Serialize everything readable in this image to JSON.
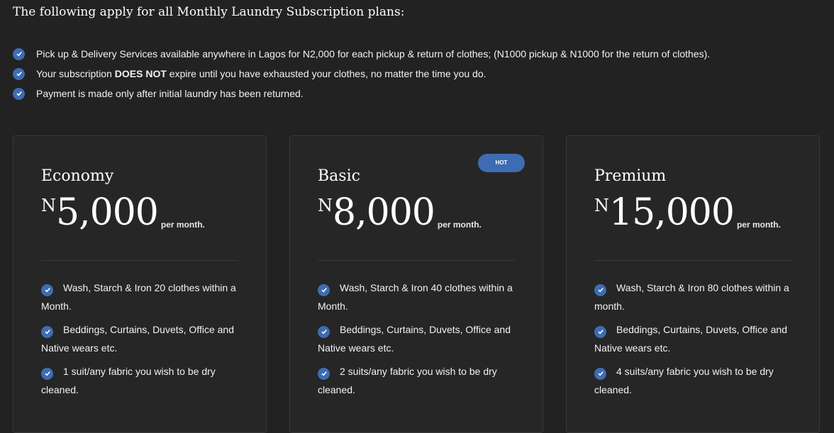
{
  "heading": "The following apply for all Monthly Laundry Subscription plans:",
  "notes": [
    {
      "text": "Pick up & Delivery Services available anywhere in Lagos for N2,000 for each pickup & return of clothes; (N1000 pickup & N1000 for the return of clothes)."
    },
    {
      "before": "Your subscription ",
      "bold": "DOES NOT",
      "after": " expire until you have exhausted your clothes, no matter the time you do."
    },
    {
      "text": "Payment is made only after initial laundry has been returned."
    }
  ],
  "check_icon": "check-circle-icon",
  "accent_color": "#3d6cb3",
  "plans": [
    {
      "name": "Economy",
      "currency": "N",
      "amount": "5,000",
      "period": "per month.",
      "features": [
        "Wash, Starch & Iron 20 clothes within a Month.",
        "Beddings, Curtains, Duvets, Office and Native wears etc.",
        "1 suit/any fabric you wish to be dry cleaned."
      ]
    },
    {
      "name": "Basic",
      "currency": "N",
      "amount": "8,000",
      "period": "per month.",
      "badge": "HOT",
      "features": [
        "Wash, Starch & Iron 40 clothes within a Month.",
        "Beddings, Curtains, Duvets, Office and Native wears etc.",
        "2 suits/any fabric you wish to be dry cleaned."
      ]
    },
    {
      "name": "Premium",
      "currency": "N",
      "amount": "15,000",
      "period": "per month.",
      "features": [
        "Wash, Starch & Iron 80 clothes within a month.",
        "Beddings, Curtains, Duvets, Office and Native wears etc.",
        "4 suits/any fabric you wish to be dry cleaned."
      ]
    }
  ]
}
